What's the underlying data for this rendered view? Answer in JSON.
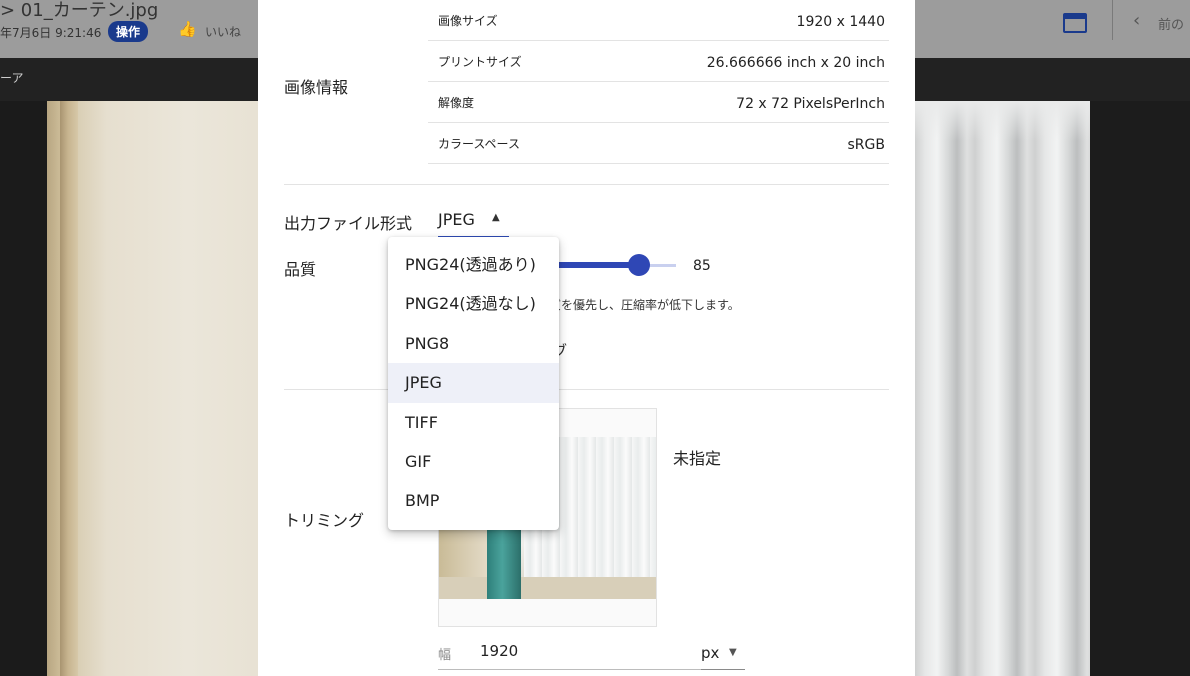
{
  "background": {
    "breadcrumb": "> 01_カーテン.jpg",
    "date": "年7月6日 9:21:46",
    "badge": "操作",
    "like": "いいね",
    "toolbar_label": "ーア",
    "prev_label": "前の"
  },
  "dialog": {
    "image_info": {
      "label": "画像情報",
      "rows": [
        {
          "key": "画像サイズ",
          "value": "1920 x 1440"
        },
        {
          "key": "プリントサイズ",
          "value": "26.666666 inch x 20 inch"
        },
        {
          "key": "解像度",
          "value": "72 x 72 PixelsPerInch"
        },
        {
          "key": "カラースペース",
          "value": "sRGB"
        }
      ]
    },
    "output_format": {
      "label": "出力ファイル形式",
      "selected": "JPEG",
      "options": [
        "PNG24(透過あり)",
        "PNG24(透過なし)",
        "PNG8",
        "JPEG",
        "TIFF",
        "GIF",
        "BMP"
      ]
    },
    "quality": {
      "label": "品質",
      "value": 85,
      "value_text": "85",
      "description_partial": "質を優先し、圧縮率が低下します。",
      "partial_text": "ブ"
    },
    "trimming": {
      "label": "トリミング",
      "status": "未指定",
      "width_label": "幅",
      "width_value": "1920",
      "unit": "px"
    }
  },
  "colors": {
    "accent": "#2f47b5",
    "badge": "#1a3a8c"
  }
}
